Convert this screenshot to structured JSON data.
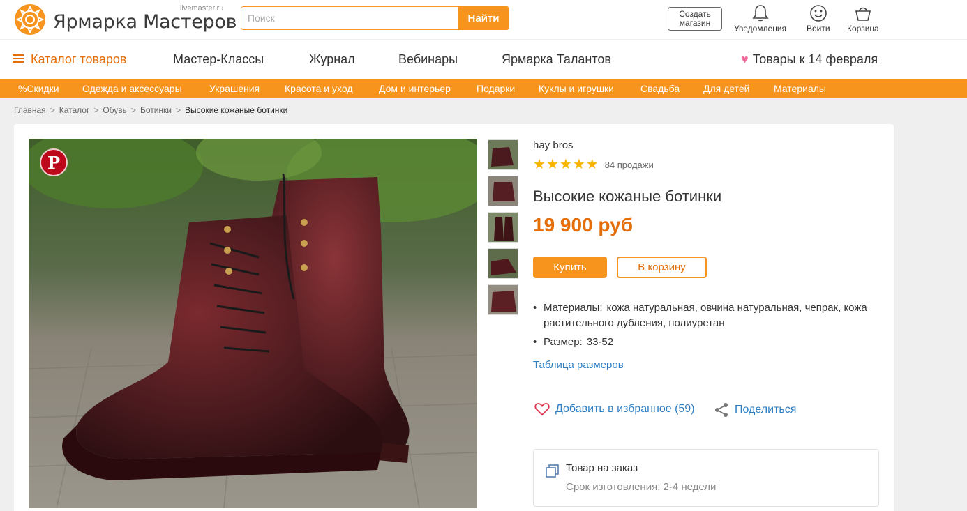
{
  "header": {
    "logo_text": "Ярмарка Мастеров",
    "logo_sub": "livemaster.ru",
    "search_placeholder": "Поиск",
    "search_button": "Найти",
    "create_shop_line1": "Создать",
    "create_shop_line2": "магазин",
    "notifications": "Уведомления",
    "login": "Войти",
    "cart": "Корзина"
  },
  "nav": {
    "catalog": "Каталог товаров",
    "items": [
      "Мастер-Классы",
      "Журнал",
      "Вебинары",
      "Ярмарка Талантов"
    ],
    "valentine": "Товары к 14 февраля"
  },
  "categories": [
    "%Скидки",
    "Одежда и аксессуары",
    "Украшения",
    "Красота и уход",
    "Дом и интерьер",
    "Подарки",
    "Куклы и игрушки",
    "Свадьба",
    "Для детей",
    "Материалы"
  ],
  "breadcrumb": [
    "Главная",
    "Каталог",
    "Обувь",
    "Ботинки",
    "Высокие кожаные ботинки"
  ],
  "product": {
    "seller": "hay bros",
    "rating": 5,
    "sales": "84 продажи",
    "title": "Высокие кожаные ботинки",
    "price": "19 900 руб",
    "buy_label": "Купить",
    "cart_label": "В корзину",
    "materials_label": "Материалы:",
    "materials_value": "кожа натуральная, овчина натуральная, чепрак, кожа растительного дубления, полиуретан",
    "size_label": "Размер:",
    "size_value": "33-52",
    "size_table": "Таблица размеров",
    "favorite": "Добавить в избранное (59)",
    "share": "Поделиться",
    "order_title": "Товар на заказ",
    "order_time": "Срок изготовления: 2-4 недели"
  },
  "colors": {
    "accent": "#f7941d",
    "accent_text": "#e46e0a",
    "link": "#2d7ec3",
    "star": "#f7b500"
  }
}
